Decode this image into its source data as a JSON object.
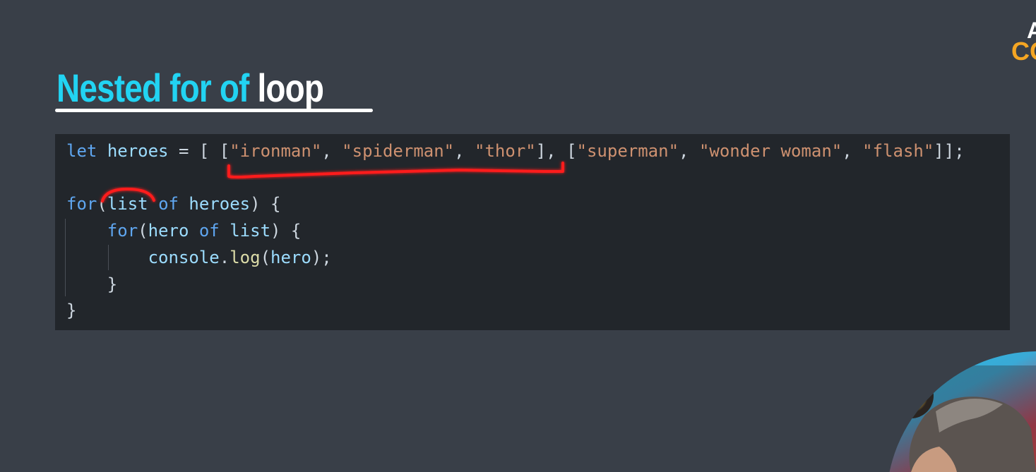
{
  "slide": {
    "title_accent": "Nested for of",
    "title_rest": "loop"
  },
  "brand": {
    "line1": "A",
    "line2": "CO"
  },
  "code": {
    "line1": {
      "t1": "let",
      "t2": " ",
      "t3": "heroes",
      "t4": " = [ [",
      "t5": "\"ironman\"",
      "t6": ", ",
      "t7": "\"spiderman\"",
      "t8": ", ",
      "t9": "\"thor\"",
      "t10": "], [",
      "t11": "\"superman\"",
      "t12": ", ",
      "t13": "\"wonder woman\"",
      "t14": ", ",
      "t15": "\"flash\"",
      "t16": "]];"
    },
    "line3": {
      "t1": "for",
      "t2": "(",
      "t3": "list",
      "t4": " ",
      "t5": "of",
      "t6": " ",
      "t7": "heroes",
      "t8": ") {"
    },
    "line4": {
      "t0": "    ",
      "t1": "for",
      "t2": "(",
      "t3": "hero",
      "t4": " ",
      "t5": "of",
      "t6": " ",
      "t7": "list",
      "t8": ") {"
    },
    "line5": {
      "t0": "        ",
      "t1": "console",
      "t2": ".",
      "t3": "log",
      "t4": "(",
      "t5": "hero",
      "t6": ");"
    },
    "line6": {
      "t0": "    ",
      "t1": "}"
    },
    "line7": {
      "t1": "}"
    }
  },
  "colors": {
    "background": "#393f48",
    "code_background": "#22262b",
    "title_accent": "#22d3f2",
    "keyword": "#5fa6f0",
    "variable": "#9cdcfe",
    "string": "#ce9170",
    "function": "#dcdca8",
    "annotation": "#ff1a1a",
    "brand_accent": "#f5a623"
  }
}
